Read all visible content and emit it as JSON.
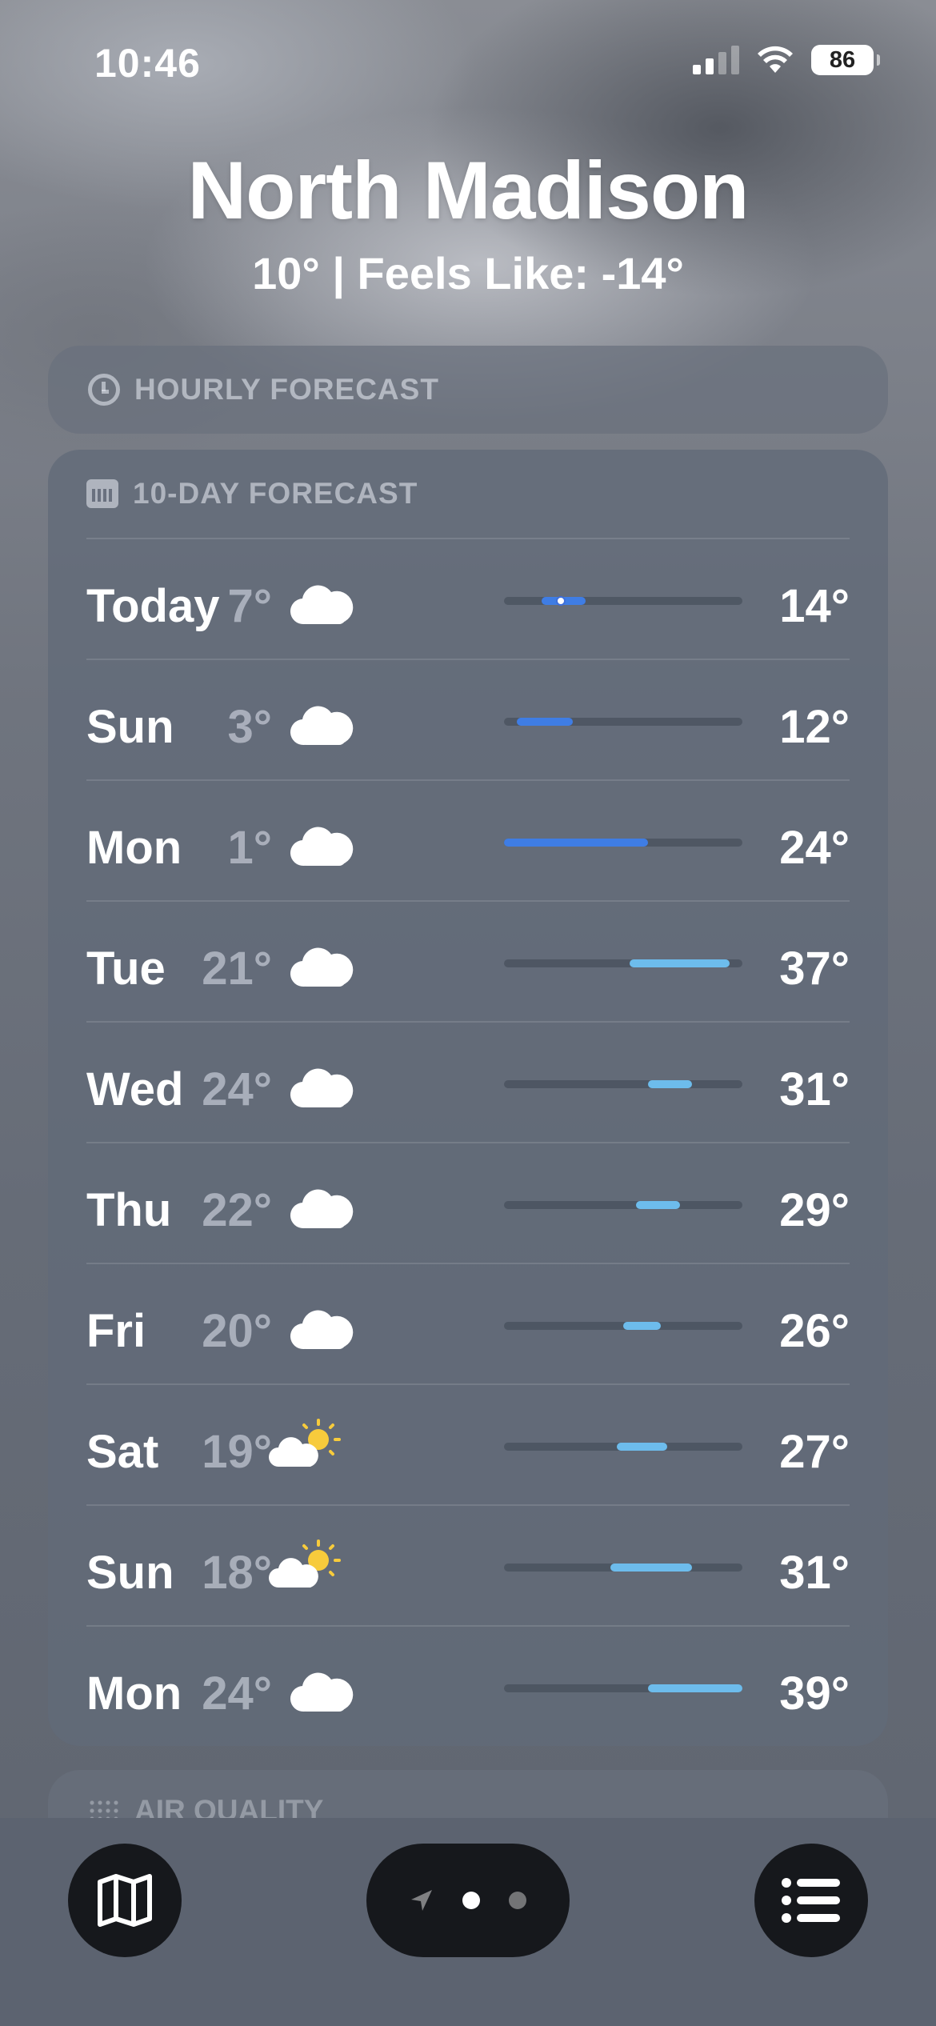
{
  "status_bar": {
    "time": "10:46",
    "battery": "86",
    "icons": [
      "cellular-signal-icon",
      "wifi-icon",
      "battery-icon"
    ]
  },
  "location": {
    "name": "North Madison",
    "temp_line": "10°  |  Feels Like: -14°"
  },
  "hourly": {
    "label": "HOURLY FORECAST",
    "icon": "clock-icon"
  },
  "ten_day": {
    "label": "10-DAY FORECAST",
    "icon": "calendar-icon",
    "scale_min": 1,
    "scale_max": 39,
    "days": [
      {
        "name": "Today",
        "icon": "cloud-icon",
        "low": "7°",
        "high": "14°",
        "low_val": 7,
        "high_val": 14,
        "color": "#3f7de4",
        "current_val": 10
      },
      {
        "name": "Sun",
        "icon": "cloud-icon",
        "low": "3°",
        "high": "12°",
        "low_val": 3,
        "high_val": 12,
        "color": "#3f7de4"
      },
      {
        "name": "Mon",
        "icon": "cloud-icon",
        "low": "1°",
        "high": "24°",
        "low_val": 1,
        "high_val": 24,
        "color": "#3f7de4"
      },
      {
        "name": "Tue",
        "icon": "cloud-icon",
        "low": "21°",
        "high": "37°",
        "low_val": 21,
        "high_val": 37,
        "color": "#6dbcec"
      },
      {
        "name": "Wed",
        "icon": "cloud-icon",
        "low": "24°",
        "high": "31°",
        "low_val": 24,
        "high_val": 31,
        "color": "#6dbcec"
      },
      {
        "name": "Thu",
        "icon": "cloud-icon",
        "low": "22°",
        "high": "29°",
        "low_val": 22,
        "high_val": 29,
        "color": "#6dbcec"
      },
      {
        "name": "Fri",
        "icon": "cloud-icon",
        "low": "20°",
        "high": "26°",
        "low_val": 20,
        "high_val": 26,
        "color": "#6dbcec"
      },
      {
        "name": "Sat",
        "icon": "partly-sunny-icon",
        "low": "19°",
        "high": "27°",
        "low_val": 19,
        "high_val": 27,
        "color": "#6dbcec"
      },
      {
        "name": "Sun",
        "icon": "partly-sunny-icon",
        "low": "18°",
        "high": "31°",
        "low_val": 18,
        "high_val": 31,
        "color": "#6dbcec"
      },
      {
        "name": "Mon",
        "icon": "cloud-icon",
        "low": "24°",
        "high": "39°",
        "low_val": 24,
        "high_val": 39,
        "color": "#6dbcec"
      }
    ]
  },
  "air_quality": {
    "label": "AIR QUALITY",
    "icon": "air-quality-icon"
  },
  "bottom_bar": {
    "map_icon": "map-icon",
    "list_icon": "list-icon",
    "location_arrow_icon": "location-arrow-icon",
    "page_count": 2,
    "active_page": 1
  }
}
